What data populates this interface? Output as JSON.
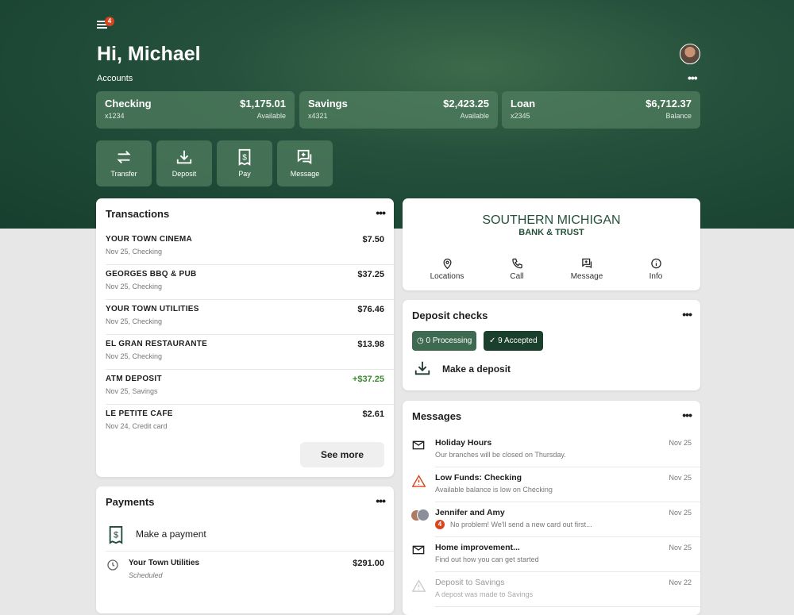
{
  "header": {
    "menu_badge": "4",
    "greeting": "Hi, Michael",
    "accounts_label": "Accounts"
  },
  "accounts": [
    {
      "name": "Checking",
      "number": "x1234",
      "amount": "$1,175.01",
      "status": "Available"
    },
    {
      "name": "Savings",
      "number": "x4321",
      "amount": "$2,423.25",
      "status": "Available"
    },
    {
      "name": "Loan",
      "number": "x2345",
      "amount": "$6,712.37",
      "status": "Balance"
    }
  ],
  "actions": [
    {
      "label": "Transfer",
      "icon": "transfer-icon"
    },
    {
      "label": "Deposit",
      "icon": "deposit-icon"
    },
    {
      "label": "Pay",
      "icon": "receipt-dollar-icon"
    },
    {
      "label": "Message",
      "icon": "message-add-icon"
    }
  ],
  "transactions": {
    "title": "Transactions",
    "see_more": "See more",
    "items": [
      {
        "merchant": "YOUR TOWN CINEMA",
        "meta": "Nov 25, Checking",
        "amount": "$7.50"
      },
      {
        "merchant": "GEORGES BBQ & PUB",
        "meta": "Nov 25, Checking",
        "amount": "$37.25"
      },
      {
        "merchant": "YOUR TOWN UTILITIES",
        "meta": "Nov 25, Checking",
        "amount": "$76.46"
      },
      {
        "merchant": "EL GRAN RESTAURANTE",
        "meta": "Nov 25, Checking",
        "amount": "$13.98"
      },
      {
        "merchant": "ATM DEPOSIT",
        "meta": "Nov 25, Savings",
        "amount": "+$37.25"
      },
      {
        "merchant": "LE PETITE CAFE",
        "meta": "Nov 24, Credit card",
        "amount": "$2.61"
      }
    ]
  },
  "payments": {
    "title": "Payments",
    "make": "Make a payment",
    "items": [
      {
        "payee": "Your Town Utilities",
        "status": "Scheduled",
        "amount": "$291.00"
      }
    ]
  },
  "bank": {
    "name_line1": "SOUTHERN MICHIGAN",
    "name_line2": "BANK & TRUST",
    "links": [
      "Locations",
      "Call",
      "Message",
      "Info"
    ]
  },
  "deposit": {
    "title": "Deposit checks",
    "processing": "0 Processing",
    "accepted": "9 Accepted",
    "make": "Make a deposit"
  },
  "messages": {
    "title": "Messages",
    "items": [
      {
        "title": "Holiday Hours",
        "body": "Our branches will be closed on Thursday.",
        "date": "Nov 25"
      },
      {
        "title": "Low Funds: Checking",
        "body": "Available balance is low on Checking",
        "date": "Nov 25"
      },
      {
        "title": "Jennifer and Amy",
        "body": "No problem! We'll send a new card out first...",
        "date": "Nov 25",
        "badge": "4"
      },
      {
        "title": "Home improvement...",
        "body": "Find out how you can get started",
        "date": "Nov 25"
      },
      {
        "title": "Deposit to Savings",
        "body": "A depost was made to Savings",
        "date": "Nov 22"
      }
    ]
  },
  "colors": {
    "brand": "#1f4a38",
    "accent_positive": "#3a8a2e",
    "alert": "#d8441c"
  }
}
